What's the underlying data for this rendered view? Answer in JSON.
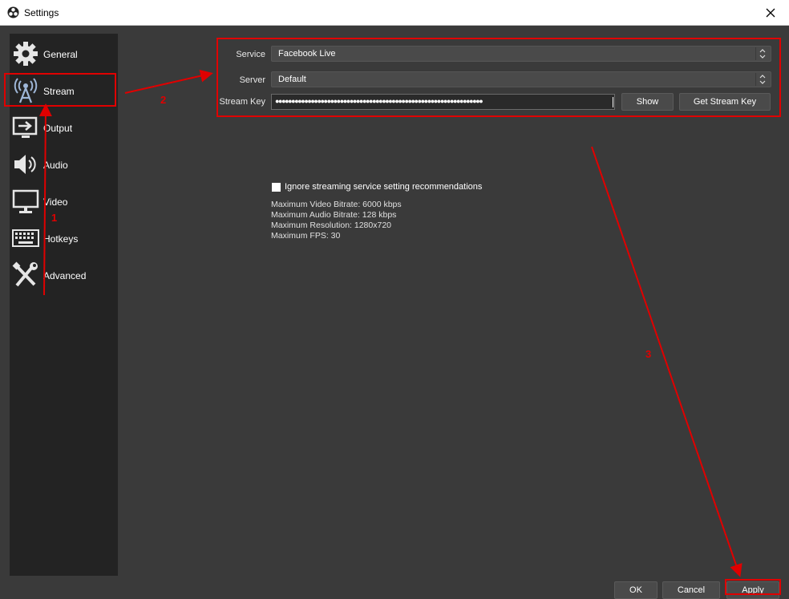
{
  "window": {
    "title": "Settings"
  },
  "sidebar": {
    "items": [
      {
        "label": "General",
        "icon": "gear-icon"
      },
      {
        "label": "Stream",
        "icon": "broadcast-antenna-icon"
      },
      {
        "label": "Output",
        "icon": "output-icon"
      },
      {
        "label": "Audio",
        "icon": "speaker-icon"
      },
      {
        "label": "Video",
        "icon": "monitor-icon"
      },
      {
        "label": "Hotkeys",
        "icon": "keyboard-icon"
      },
      {
        "label": "Advanced",
        "icon": "tools-icon"
      }
    ],
    "selected": "Stream"
  },
  "stream": {
    "service_label": "Service",
    "service_value": "Facebook Live",
    "server_label": "Server",
    "server_value": "Default",
    "key_label": "Stream Key",
    "key_value": "●●●●●●●●●●●●●●●●●●●●●●●●●●●●●●●●●●●●●●●●●●●●●●●●●●●●●●●●●●●●●●●●",
    "show_label": "Show",
    "get_key_label": "Get Stream Key"
  },
  "options": {
    "ignore_label": "Ignore streaming service setting recommendations",
    "ignore_checked": false,
    "info": [
      "Maximum Video Bitrate: 6000 kbps",
      "Maximum Audio Bitrate: 128 kbps",
      "Maximum Resolution: 1280x720",
      "Maximum FPS: 30"
    ]
  },
  "footer": {
    "ok_label": "OK",
    "cancel_label": "Cancel",
    "apply_label": "Apply"
  },
  "annotations": {
    "step1": "1",
    "step2": "2",
    "step3": "3"
  },
  "colors": {
    "annotation": "#e00000",
    "background": "#3a3a3a",
    "sidebar": "#232323"
  }
}
